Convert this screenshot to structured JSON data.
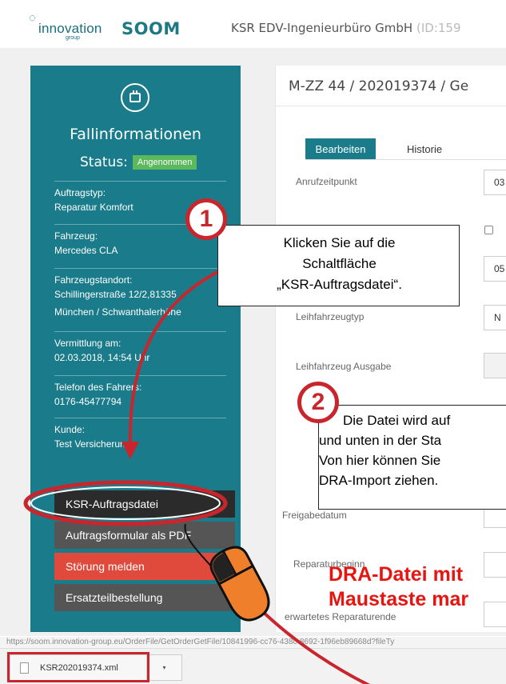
{
  "header": {
    "logo_text": "innovation",
    "logo_sub": "group",
    "brand": "SOOM",
    "company": "KSR EDV-Ingenieurbüro GmbH",
    "company_id": "(ID:159"
  },
  "sidebar": {
    "title": "Fallinformationen",
    "status_label": "Status:",
    "status_badge": "Angenommen",
    "fields": [
      {
        "label": "Auftragstyp:",
        "value": "Reparatur Komfort"
      },
      {
        "label": "Fahrzeug:",
        "value": "Mercedes CLA"
      },
      {
        "label": "Fahrzeugstandort:",
        "value": "Schillingerstraße 12/2,81335",
        "value2": "München / Schwanthalerhöhe"
      },
      {
        "label": "Vermittlung am:",
        "value": "02.03.2018, 14:54 Uhr"
      },
      {
        "label": "Telefon des Fahrers:",
        "value": "0176-45477794"
      },
      {
        "label": "Kunde:",
        "value": "Test Versicherung"
      }
    ],
    "buttons": [
      {
        "label": "KSR-Auftragsdatei",
        "color": "#2b2b2b"
      },
      {
        "label": "Auftragsformular als PDF",
        "color": "#555555"
      },
      {
        "label": "Störung melden",
        "color": "#e04a3c"
      },
      {
        "label": "Ersatzteilbestellung",
        "color": "#555555"
      }
    ]
  },
  "main": {
    "title": "M-ZZ 44 / 202019374 / Ge",
    "tabs": [
      "Bearbeiten",
      "Historie"
    ],
    "fields": [
      {
        "label": "Anrufzeitpunkt",
        "value": "03"
      },
      {
        "label": "Leihfahrzeugtyp",
        "value": "N"
      },
      {
        "label": "Leihfahrzeug Ausgabe",
        "value": ""
      },
      {
        "label": "Freigabedatum",
        "value": ""
      },
      {
        "label": "Reparaturbeginn",
        "value": ""
      },
      {
        "label": "erwartetes Reparaturende",
        "value": ""
      }
    ],
    "extra_value": "05"
  },
  "statusbar": {
    "url": "https://soom.innovation-group.eu/OrderFile/GetOrderGetFile/10841996-cc76-438c-8692-1f96eb89668d?fileTy"
  },
  "download": {
    "filename": "KSR202019374.xml",
    "arrow": "▾"
  },
  "annotations": {
    "step1_number": "1",
    "step1_text": [
      "Klicken Sie auf die",
      "Schaltfläche",
      "„KSR-Auftragsdatei“."
    ],
    "step2_number": "2",
    "step2_text": [
      "Die Datei wird auf",
      "und unten in der Sta",
      "Von hier können Sie",
      "DRA-Import ziehen."
    ],
    "red_text": [
      "DRA-Datei mit",
      "Maustaste mar"
    ],
    "accent_color": "#c8262c"
  }
}
